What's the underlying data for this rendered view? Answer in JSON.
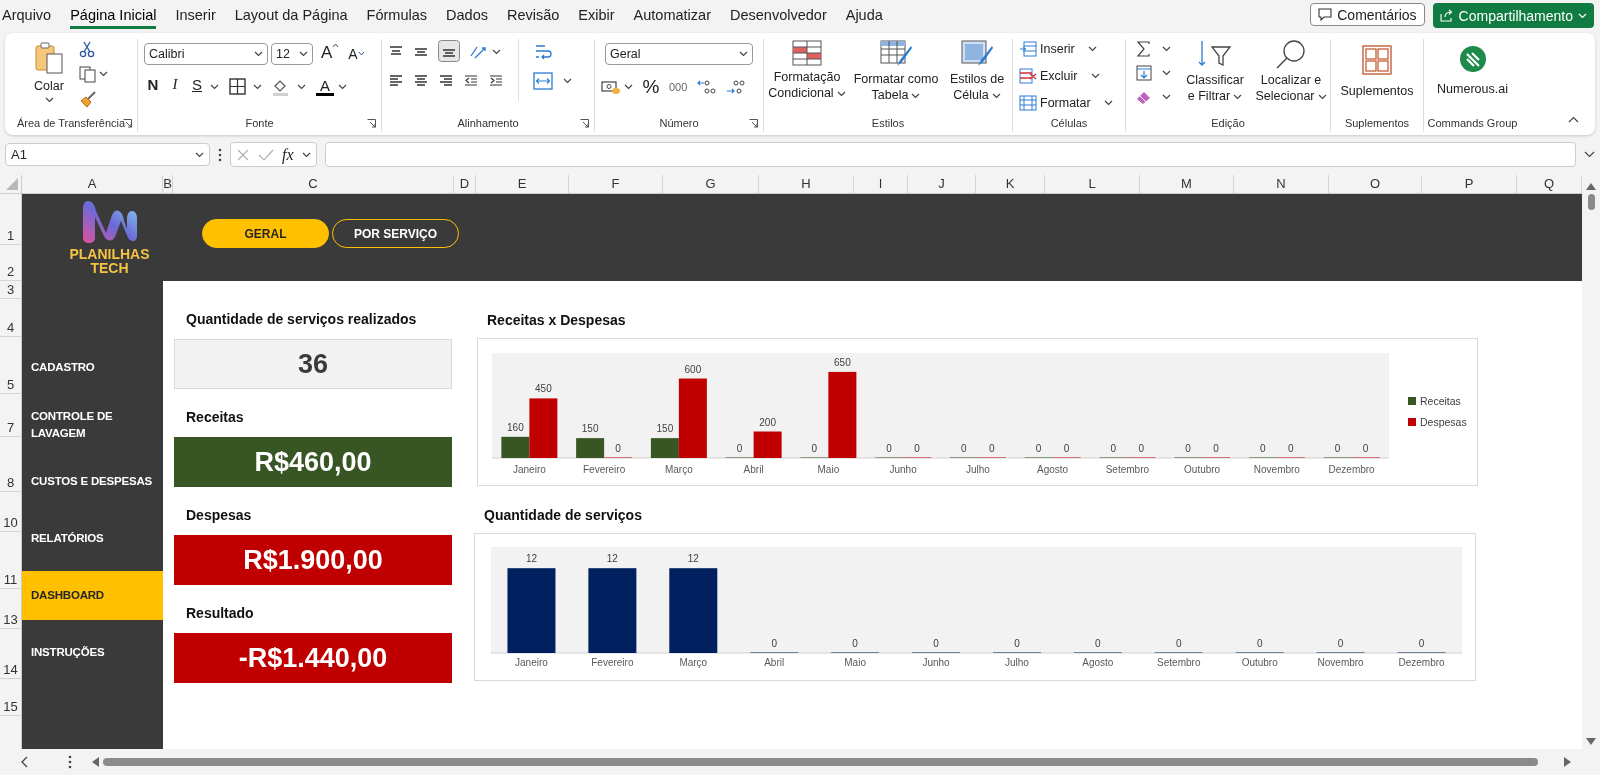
{
  "menu": {
    "tabs": [
      {
        "label": "Arquivo",
        "selected": false
      },
      {
        "label": "Página Inicial",
        "selected": true
      },
      {
        "label": "Inserir",
        "selected": false
      },
      {
        "label": "Layout da Página",
        "selected": false
      },
      {
        "label": "Fórmulas",
        "selected": false
      },
      {
        "label": "Dados",
        "selected": false
      },
      {
        "label": "Revisão",
        "selected": false
      },
      {
        "label": "Exibir",
        "selected": false
      },
      {
        "label": "Automatizar",
        "selected": false
      },
      {
        "label": "Desenvolvedor",
        "selected": false
      },
      {
        "label": "Ajuda",
        "selected": false
      }
    ],
    "comments_button": "Comentários",
    "share_button": "Compartilhamento"
  },
  "ribbon": {
    "clipboard": {
      "label": "Área de Transferência",
      "paste": "Colar"
    },
    "font": {
      "label": "Fonte",
      "family": "Calibri",
      "size": "12",
      "grow": "A",
      "shrink": "A",
      "bold": "N",
      "italic": "I",
      "underline": "S",
      "font_color": "A"
    },
    "alignment": {
      "label": "Alinhamento"
    },
    "number": {
      "label": "Número",
      "format": "Geral",
      "percent": "%",
      "thousands": "000"
    },
    "styles": {
      "label": "Estilos",
      "buttons": [
        "Formatação Condicional",
        "Formatar como Tabela",
        "Estilos de Célula"
      ]
    },
    "cells": {
      "label": "Células",
      "buttons": [
        "Inserir",
        "Excluir",
        "Formatar"
      ]
    },
    "editing": {
      "label": "Edição",
      "sort": "Classificar e Filtrar",
      "find": "Localizar e Selecionar"
    },
    "addins": {
      "label": "Suplementos",
      "button": "Suplementos"
    },
    "commands": {
      "label": "Commands Group",
      "button": "Numerous.ai"
    }
  },
  "formula_bar": {
    "name_box": "A1",
    "fx": "fx"
  },
  "sheet": {
    "columns": [
      "A",
      "B",
      "C",
      "D",
      "E",
      "F",
      "G",
      "H",
      "I",
      "J",
      "K",
      "L",
      "M",
      "N",
      "O",
      "P",
      "Q"
    ],
    "rows": [
      "1",
      "2",
      "3",
      "4",
      "5",
      "7",
      "8",
      "10",
      "11",
      "13",
      "14",
      "15"
    ]
  },
  "dashboard": {
    "logo_text": "PLANILHAS TECH",
    "view_buttons": [
      {
        "label": "GERAL",
        "selected": true
      },
      {
        "label": "POR SERVIÇO",
        "selected": false
      }
    ],
    "nav": [
      {
        "label": "CADASTRO",
        "selected": false
      },
      {
        "label": "CONTROLE DE LAVAGEM",
        "selected": false
      },
      {
        "label": "CUSTOS E DESPESAS",
        "selected": false
      },
      {
        "label": "RELATÓRIOS",
        "selected": false
      },
      {
        "label": "DASHBOARD",
        "selected": true
      },
      {
        "label": "INSTRUÇÕES",
        "selected": false
      }
    ],
    "kpis": [
      {
        "title": "Quantidade de serviços realizados",
        "value": "36",
        "kind": "neutral"
      },
      {
        "title": "Receitas",
        "value": "R$460,00",
        "kind": "positive"
      },
      {
        "title": "Despesas",
        "value": "R$1.900,00",
        "kind": "negative"
      },
      {
        "title": "Resultado",
        "value": "-R$1.440,00",
        "kind": "negative"
      }
    ],
    "charts": [
      {
        "chart_data": {
          "type": "bar",
          "title": "Receitas x Despesas",
          "categories": [
            "Janeiro",
            "Fevereiro",
            "Março",
            "Abril",
            "Maio",
            "Junho",
            "Julho",
            "Agosto",
            "Setembro",
            "Outubro",
            "Novembro",
            "Dezembro"
          ],
          "series": [
            {
              "name": "Receitas",
              "color": "#375623",
              "values": [
                160,
                150,
                150,
                0,
                0,
                0,
                0,
                0,
                0,
                0,
                0,
                0
              ]
            },
            {
              "name": "Despesas",
              "color": "#c00000",
              "values": [
                450,
                0,
                600,
                200,
                650,
                0,
                0,
                0,
                0,
                0,
                0,
                0
              ]
            }
          ],
          "legend": "right",
          "data_labels": true
        }
      },
      {
        "chart_data": {
          "type": "bar",
          "title": "Quantidade de serviços",
          "categories": [
            "Janeiro",
            "Fevereiro",
            "Março",
            "Abril",
            "Maio",
            "Junho",
            "Julho",
            "Agosto",
            "Setembro",
            "Outubro",
            "Novembro",
            "Dezembro"
          ],
          "series": [
            {
              "color": "#002060",
              "values": [
                12,
                12,
                12,
                0,
                0,
                0,
                0,
                0,
                0,
                0,
                0,
                0
              ]
            }
          ],
          "data_labels": true
        }
      }
    ]
  }
}
